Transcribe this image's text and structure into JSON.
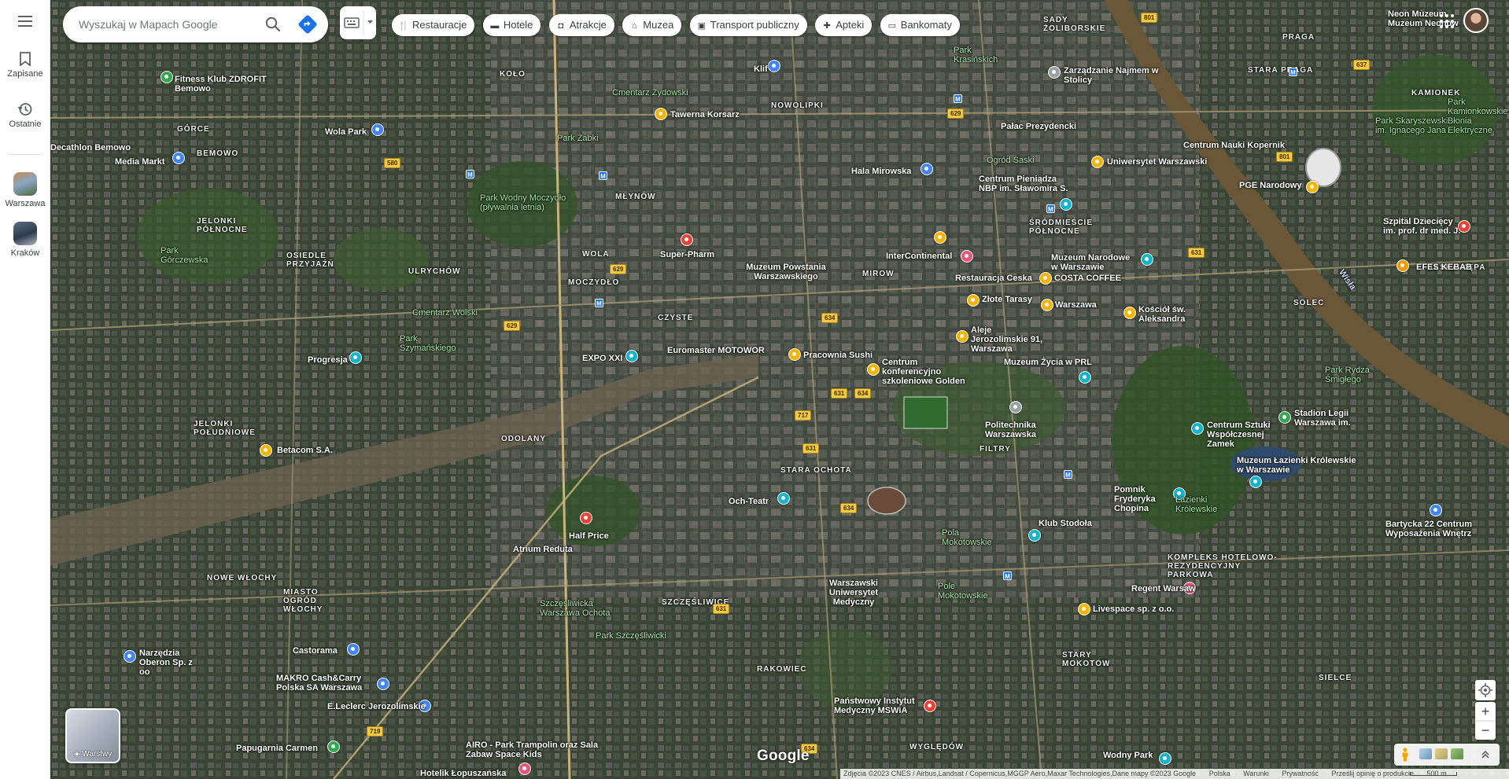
{
  "rail": {
    "saved_label": "Zapisane",
    "recent_label": "Ostatnie",
    "recent_places": [
      {
        "label": "Warszawa"
      },
      {
        "label": "Kraków"
      }
    ]
  },
  "search": {
    "placeholder": "Wyszukaj w Mapach Google"
  },
  "categories": [
    {
      "label": "Restauracje",
      "icon": "fork-knife-icon"
    },
    {
      "label": "Hotele",
      "icon": "bed-icon"
    },
    {
      "label": "Atrakcje",
      "icon": "camera-icon"
    },
    {
      "label": "Muzea",
      "icon": "museum-icon"
    },
    {
      "label": "Transport publiczny",
      "icon": "train-icon"
    },
    {
      "label": "Apteki",
      "icon": "pharmacy-icon"
    },
    {
      "label": "Bankomaty",
      "icon": "atm-icon"
    }
  ],
  "layers": {
    "label": "Warstwy"
  },
  "map": {
    "districts": [
      "KOŁO",
      "NOWOLIPKI",
      "MŁYNÓW",
      "MIROW",
      "CZYSTE",
      "WOLA",
      "ULRYCHÓW",
      "GÓRCE",
      "BEMOWO",
      "JELONKI PÓŁNOCNE",
      "OSIEDLE PRZYJAŹŃ",
      "MOCZYDŁO",
      "ODOLANY",
      "JELONKI POŁUDNIOWE",
      "STARA OCHOTA",
      "FILTRY",
      "NOWE WŁOCHY",
      "MIASTO OGRÓD WŁOCHY",
      "SZCZĘŚLIWICE",
      "RAKOWIEC",
      "STARY MOKOTÓW",
      "WYGLĘDÓW",
      "ŚRÓDMIEŚCIE PÓŁNOCNE",
      "STARA PRAGA",
      "PRAGA",
      "SADY ŻOLIBORSKIE",
      "SOLEC",
      "SIELCE",
      "KOMPLEKS HOTELOWO-REZYDENCYJNY PARKOWA",
      "SASKA KĘPA",
      "KAMIONEK"
    ],
    "places": [
      {
        "name": "Neon Muzeum"
      },
      {
        "name": "Muzeum Neonów"
      },
      {
        "name": "Zarządzanie Najmem w Stolicy"
      },
      {
        "name": "Fitness Klub ZDROFIT Bemowo"
      },
      {
        "name": "Decathlon Bemowo"
      },
      {
        "name": "Media Markt"
      },
      {
        "name": "Wola Park"
      },
      {
        "name": "Tawerna Korsarz"
      },
      {
        "name": "Klif"
      },
      {
        "name": "Pałac Prezydencki"
      },
      {
        "name": "Centrum Nauki Kopernik"
      },
      {
        "name": "Uniwersytet Warszawski"
      },
      {
        "name": "PGE Narodowy"
      },
      {
        "name": "Szpital Dziecięcy im. prof. dr med. J."
      },
      {
        "name": "Hala Mirowska"
      },
      {
        "name": "Centrum Pieniądza NBP im. Sławomira S."
      },
      {
        "name": "Super-Pharm"
      },
      {
        "name": "Muzeum Powstania Warszawskiego"
      },
      {
        "name": "InterContinental"
      },
      {
        "name": "Muzeum Narodowe w Warszawie"
      },
      {
        "name": "Restauracja Ceska"
      },
      {
        "name": "COSTA COFFEE"
      },
      {
        "name": "Złote Tarasy"
      },
      {
        "name": "Warszawa"
      },
      {
        "name": "Kościół św. Aleksandra"
      },
      {
        "name": "EFES KEBAB"
      },
      {
        "name": "Aleje Jerozolimskie 91, Warszawa"
      },
      {
        "name": "Muzeum Życia w PRL"
      },
      {
        "name": "EXPO XXI"
      },
      {
        "name": "Euromaster MOTOWOR"
      },
      {
        "name": "Pracownia Sushi"
      },
      {
        "name": "Centrum konferencyjno szkoleniowe Golden"
      },
      {
        "name": "Progresja"
      },
      {
        "name": "Betacom S.A."
      },
      {
        "name": "Politechnika Warszawska"
      },
      {
        "name": "Centrum Sztuki Współczesnej Zamek"
      },
      {
        "name": "Stadion Legii Warszawa im."
      },
      {
        "name": "Muzeum Łazienki Królewskie w Warszawie"
      },
      {
        "name": "Pomnik Fryderyka Chopina"
      },
      {
        "name": "Klub Stodoła"
      },
      {
        "name": "Och-Teatr"
      },
      {
        "name": "Atrium Reduta"
      },
      {
        "name": "Half Price"
      },
      {
        "name": "Regent Warsaw"
      },
      {
        "name": "Livespace sp. z o.o."
      },
      {
        "name": "Bartycka 22 Centrum Wyposażenia Wnętrz"
      },
      {
        "name": "Narzędzia Oberon Sp. z oo"
      },
      {
        "name": "Castorama"
      },
      {
        "name": "MAKRO Cash&Carry Polska SA Warszawa"
      },
      {
        "name": "E.Leclerc Jerozolimskie"
      },
      {
        "name": "Papugarnia Carmen"
      },
      {
        "name": "AIRO - Park Trampolin oraz Sala Zabaw Space Kids"
      },
      {
        "name": "Hotelik Łopuszańska"
      },
      {
        "name": "Państwowy Instytut Medyczny MSWiA"
      },
      {
        "name": "Warszawski Uniwersytet Medyczny"
      },
      {
        "name": "Wodny Park"
      }
    ],
    "green_areas": [
      "Cmentarz Żydowski",
      "Park Wodny Moczydło (pływalnia letnia)",
      "Park Górczewska",
      "Cmentarz Wolski",
      "Park Szymańskiego",
      "Park Szczęśliwicki",
      "Pola Mokotowskie",
      "Łazienki Królewskie",
      "Ogród Saski",
      "Park Skaryszewski im. Ignacego Jana",
      "Park Rydza Śmigłego",
      "Park Krasińskich",
      "Pole Mokotowskie",
      "Park Żabki",
      "Szczęśliwicka Warszawa Ochota",
      "Park Kamionkowskie Błonia Elektryczne"
    ],
    "road_numbers": [
      "801",
      "629",
      "580",
      "629",
      "629",
      "634",
      "631",
      "634",
      "717",
      "631",
      "634",
      "631",
      "719",
      "634",
      "801",
      "637",
      "631"
    ],
    "river": "Wisła"
  },
  "map_logo": "Google",
  "attribution": {
    "imagery": "Zdjęcia ©2023 CNES / Airbus,Landsat / Copernicus,MGGP Aero,Maxar Technologies,Dane mapy ©2023 Google",
    "country": "Polska",
    "terms": "Warunki",
    "privacy": "Prywatność",
    "feedback": "Prześlij opinię o produkcie",
    "scale": "500 m"
  },
  "colors": {
    "accent": "#1a73e8",
    "river": "#6a5738",
    "imagery_dark": "#2a3327",
    "imagery_mid": "#4a5741",
    "road": "#c9b37a"
  }
}
